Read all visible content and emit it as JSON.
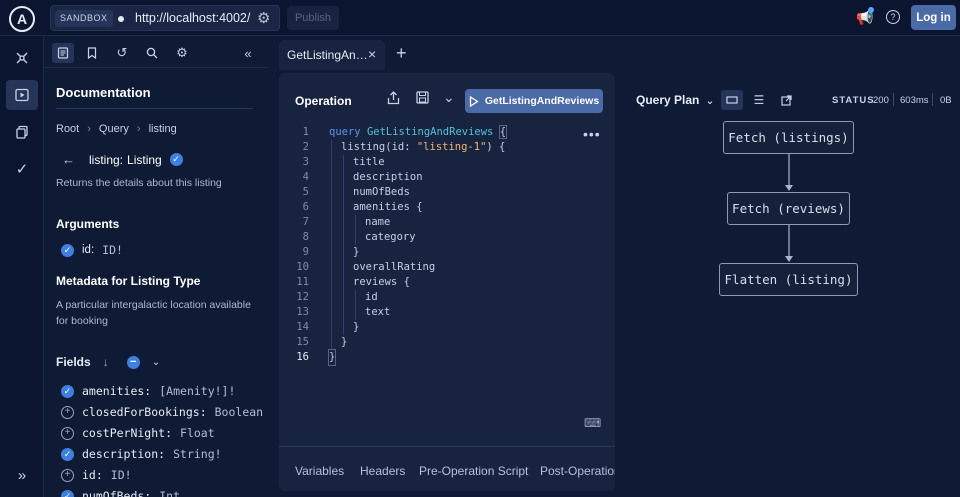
{
  "topbar": {
    "logo_letter": "A",
    "sandbox_label": "SANDBOX",
    "url": "http://localhost:4002/",
    "publish_label": "Publish",
    "login_label": "Log in"
  },
  "docs": {
    "title": "Documentation",
    "breadcrumb": [
      "Root",
      "Query",
      "listing"
    ],
    "field_label": "listing:",
    "field_type": "Listing",
    "description": "Returns the details about this listing",
    "arguments_title": "Arguments",
    "argument": {
      "name": "id:",
      "type": "ID!"
    },
    "metadata_title": "Metadata for Listing Type",
    "metadata_desc": "A particular intergalactic location available for booking",
    "fields_title": "Fields",
    "fields": [
      {
        "name": "amenities:",
        "type": "[Amenity!]!",
        "selected": true
      },
      {
        "name": "closedForBookings:",
        "type": "Boolean",
        "selected": false
      },
      {
        "name": "costPerNight:",
        "type": "Float",
        "selected": false
      },
      {
        "name": "description:",
        "type": "String!",
        "selected": true
      },
      {
        "name": "id:",
        "type": "ID!",
        "selected": true
      },
      {
        "name": "numOfBeds:",
        "type": "Int",
        "selected": true
      }
    ]
  },
  "tab": {
    "label": "GetListingAn…"
  },
  "operation": {
    "title": "Operation",
    "run_label": "GetListingAndReviews",
    "line_numbers": [
      "1",
      "2",
      "3",
      "4",
      "5",
      "6",
      "7",
      "8",
      "9",
      "10",
      "11",
      "12",
      "13",
      "14",
      "15",
      "16"
    ],
    "code": {
      "l1_kw": "query",
      "l1_name": "GetListingAndReviews",
      "l1_brace": "{",
      "l2_a": "listing(id: ",
      "l2_str": "\"listing-1\"",
      "l2_b": ") {",
      "l3": "title",
      "l4": "description",
      "l5": "numOfBeds",
      "l6": "amenities {",
      "l7": "name",
      "l8": "category",
      "l9": "}",
      "l10": "overallRating",
      "l11": "reviews {",
      "l12": "id",
      "l13": "text",
      "l14": "}",
      "l15": "}",
      "l16": "}"
    },
    "footer_tabs": [
      "Variables",
      "Headers",
      "Pre-Operation Script",
      "Post-Operation"
    ]
  },
  "query_plan": {
    "title": "Query Plan",
    "status_label": "STATUS",
    "status_code": "200",
    "time": "603ms",
    "size": "0B",
    "nodes": [
      "Fetch (listings)",
      "Fetch (reviews)",
      "Flatten (listing)"
    ]
  },
  "colors": {
    "accent": "#4b6aa8",
    "check": "#3f7fe0",
    "background": "#0f1a34"
  }
}
